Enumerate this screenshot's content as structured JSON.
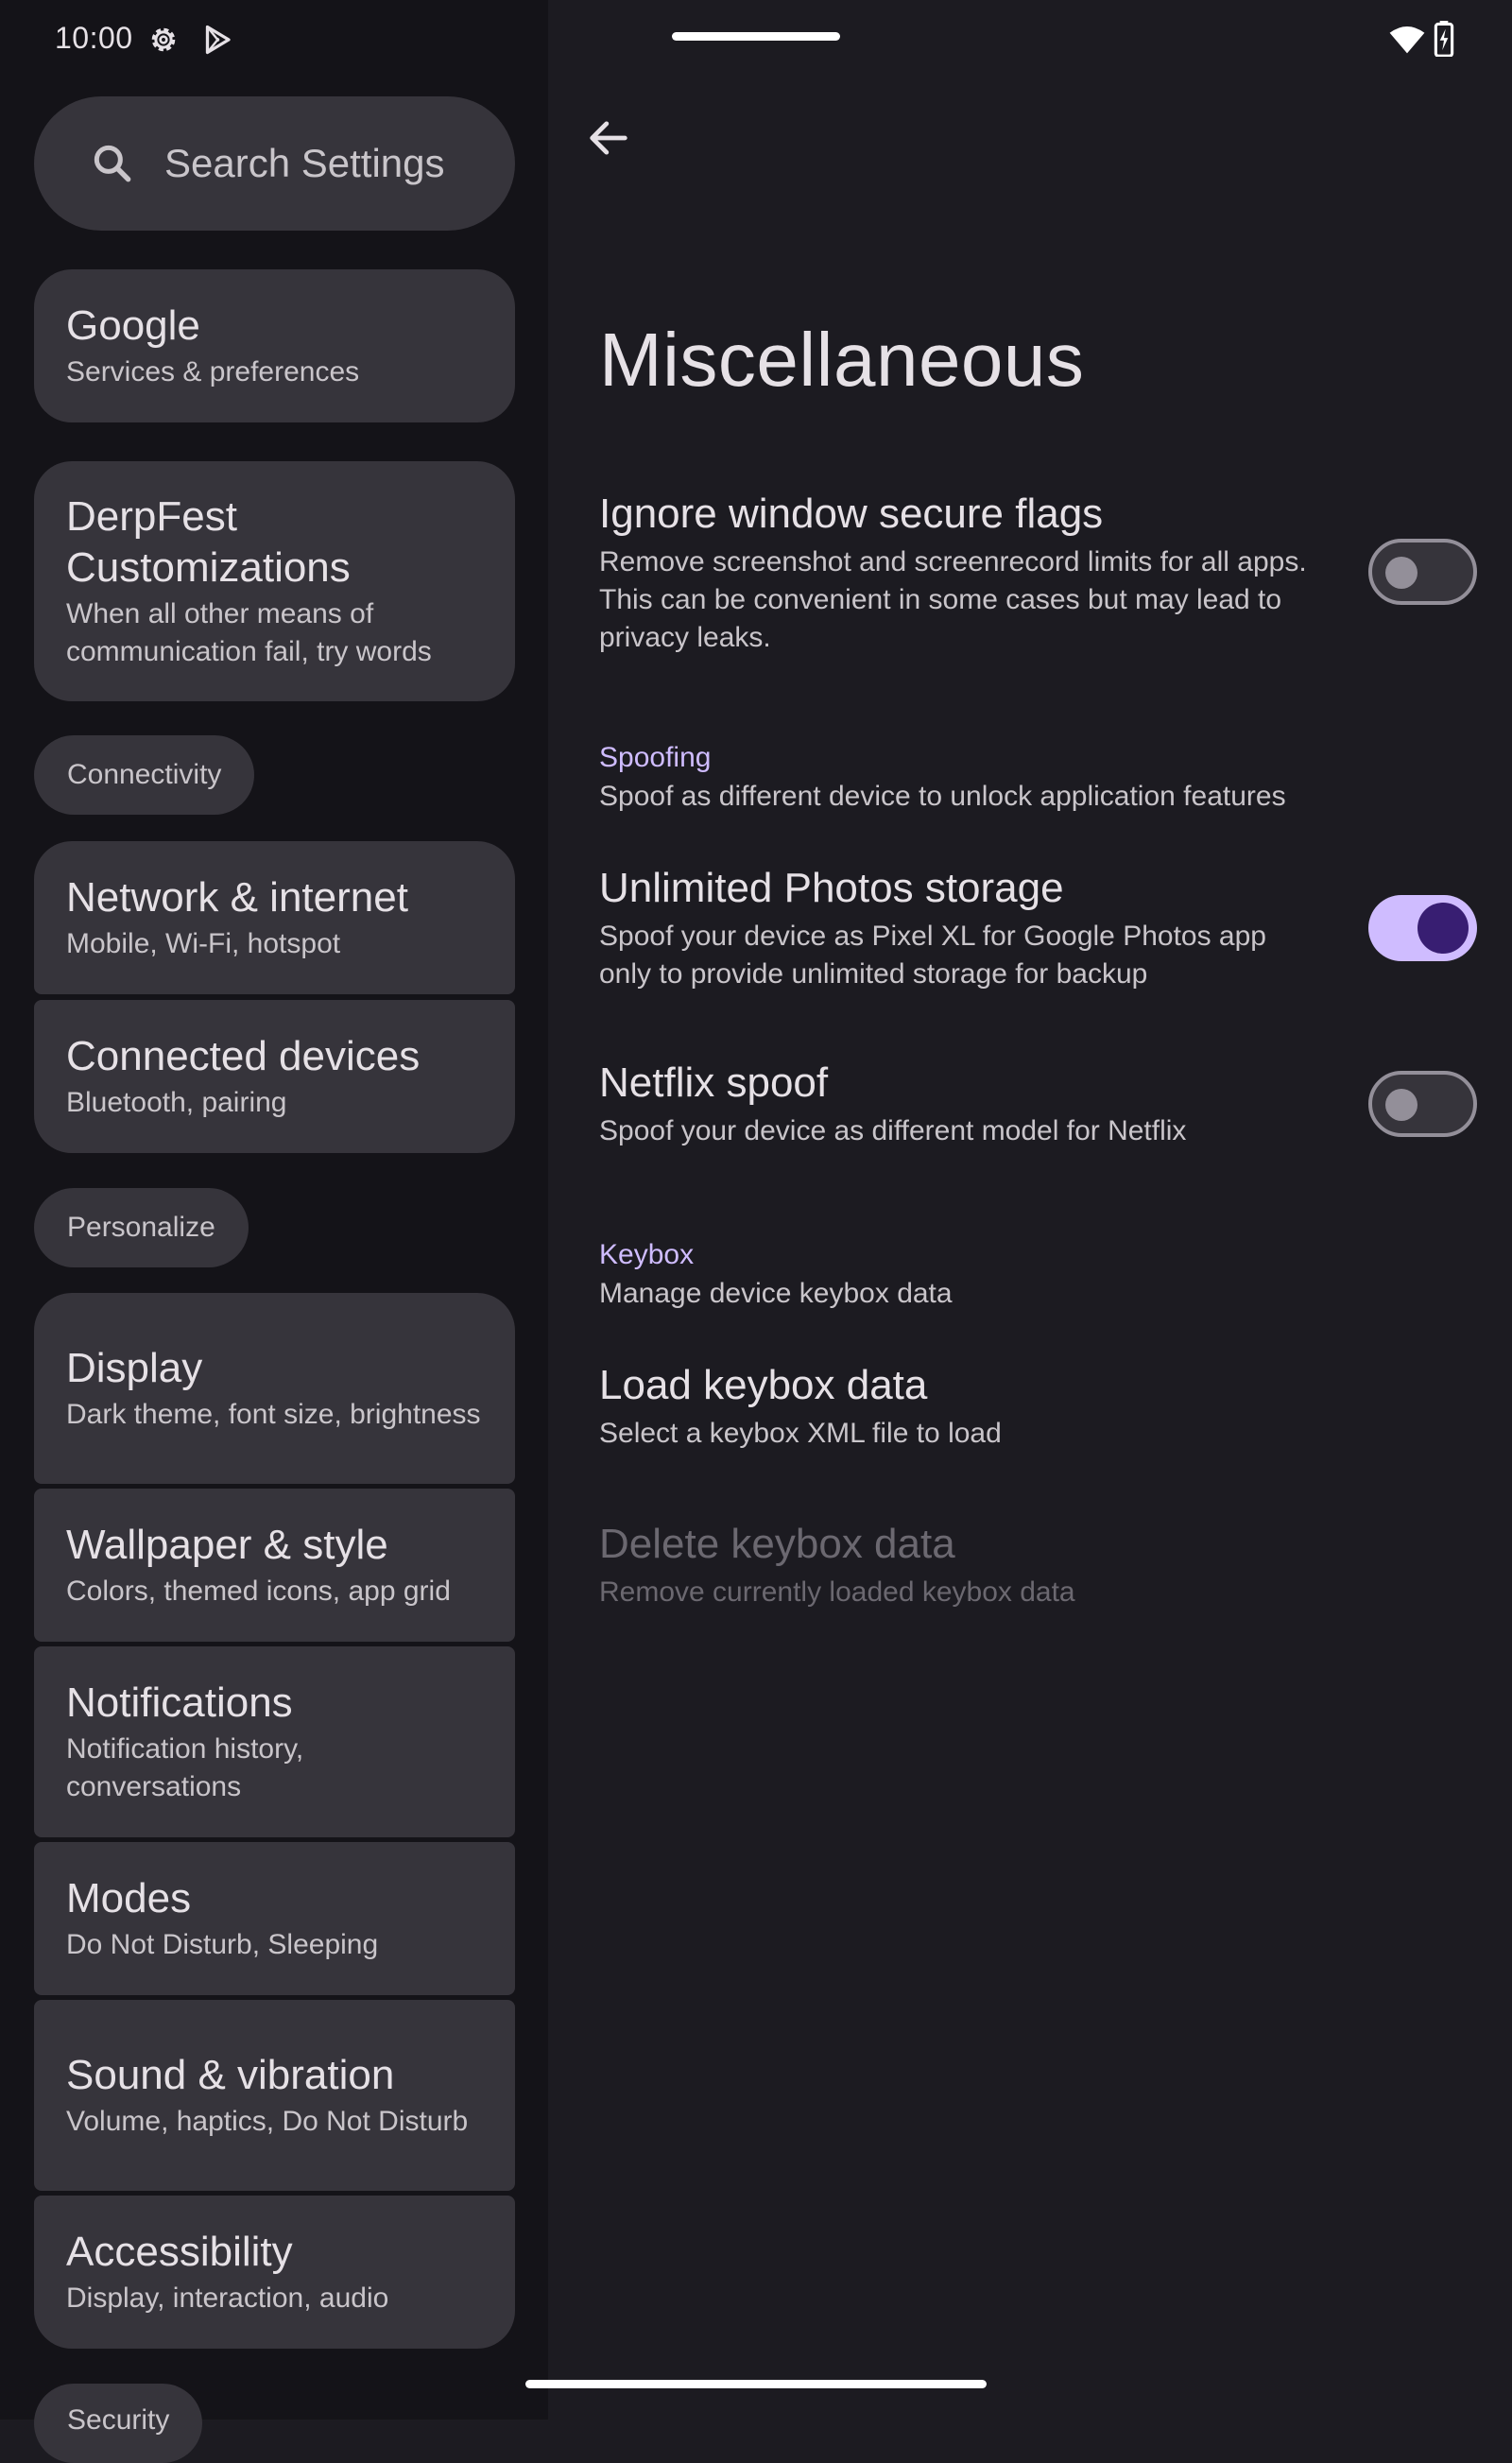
{
  "status_bar": {
    "time": "10:00"
  },
  "search": {
    "placeholder": "Search Settings"
  },
  "sidebar": {
    "cards": [
      {
        "title": "Google",
        "subtitle": "Services & preferences"
      },
      {
        "title": "DerpFest Customizations",
        "subtitle": "When all other means of communication fail, try words"
      },
      {
        "title": "Network & internet",
        "subtitle": "Mobile, Wi-Fi, hotspot"
      },
      {
        "title": "Connected devices",
        "subtitle": "Bluetooth, pairing"
      },
      {
        "title": "Display",
        "subtitle": "Dark theme, font size, brightness"
      },
      {
        "title": "Wallpaper & style",
        "subtitle": "Colors, themed icons, app grid"
      },
      {
        "title": "Notifications",
        "subtitle": "Notification history, conversations"
      },
      {
        "title": "Modes",
        "subtitle": "Do Not Disturb, Sleeping"
      },
      {
        "title": "Sound & vibration",
        "subtitle": "Volume, haptics, Do Not Disturb"
      },
      {
        "title": "Accessibility",
        "subtitle": "Display, interaction, audio"
      }
    ],
    "chips": [
      "Connectivity",
      "Personalize",
      "Security"
    ]
  },
  "page": {
    "title": "Miscellaneous",
    "items": {
      "ignore_secure": {
        "title": "Ignore window secure flags",
        "subtitle": "Remove screenshot and screenrecord limits for all apps. This can be convenient in some cases but may lead to privacy leaks.",
        "enabled": false
      },
      "spoofing_category": {
        "title": "Spoofing",
        "subtitle": "Spoof as different device to unlock application features"
      },
      "unlimited_photos": {
        "title": "Unlimited Photos storage",
        "subtitle": "Spoof your device as Pixel XL for Google Photos app only to provide unlimited storage for backup",
        "enabled": true
      },
      "netflix_spoof": {
        "title": "Netflix spoof",
        "subtitle": "Spoof your device as different model for Netflix",
        "enabled": false
      },
      "keybox_category": {
        "title": "Keybox",
        "subtitle": "Manage device keybox data"
      },
      "load_keybox": {
        "title": "Load keybox data",
        "subtitle": "Select a keybox XML file to load"
      },
      "delete_keybox": {
        "title": "Delete keybox data",
        "subtitle": "Remove currently loaded keybox data",
        "disabled": true
      }
    }
  },
  "colors": {
    "accent": "#cfbcff",
    "background": "#1c1b21",
    "sidebar_background": "#141318",
    "card": "#36343b"
  }
}
